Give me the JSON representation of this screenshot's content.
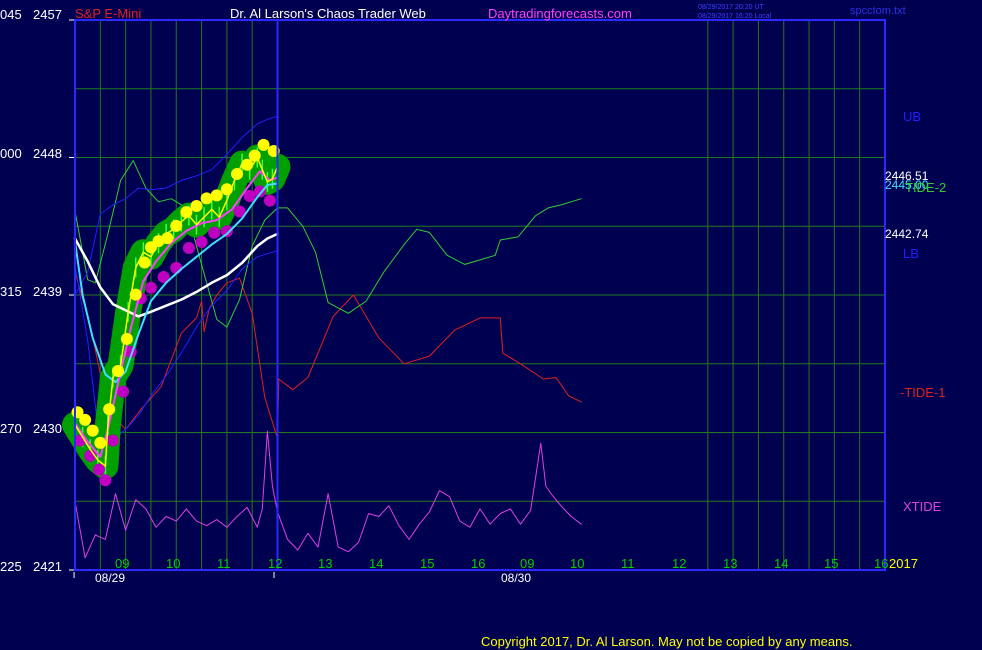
{
  "header": {
    "symbol": "S&P E-Mini",
    "title": "Dr. Al Larson's Chaos Trader Web",
    "site": "Daytradingforecasts.com",
    "timestamp_ut": "08/29/2017 20:20 UT",
    "timestamp_local": "08/29/2017 16:20 Local",
    "filename": "spcctom.txt"
  },
  "footer": {
    "copyright": "Copyright 2017, Dr. Al Larson. May not be copied by any means."
  },
  "colors": {
    "background": "#000050",
    "frame": "#2a2aff",
    "grid": "#1f7a1f",
    "price_band": "#00a000",
    "price_line": "#ffff00",
    "fast_avg": "#ff40ff",
    "slow_avg": "#40e0ff",
    "long_avg": "#ffffff",
    "band": "#2020ff",
    "tide1": "#e02020",
    "tide2": "#30d030",
    "xtide": "#e040e0"
  },
  "chart_data": {
    "type": "line",
    "title": "S&P E-Mini",
    "y_left_ticks": [
      {
        "code": "045",
        "price": "2457",
        "value": 2457
      },
      {
        "code": "000",
        "price": "2448",
        "value": 2448
      },
      {
        "code": "315",
        "price": "2439",
        "value": 2439
      },
      {
        "code": "270",
        "price": "2430",
        "value": 2430
      },
      {
        "code": "225",
        "price": "2421",
        "value": 2421
      }
    ],
    "ylim": [
      2421,
      2457
    ],
    "x_hour_ticks": [
      "09",
      "10",
      "11",
      "12",
      "13",
      "14",
      "15",
      "16",
      "09",
      "10",
      "11",
      "12",
      "13",
      "14",
      "15",
      "16"
    ],
    "x_hour_values": [
      9,
      10,
      11,
      12,
      13,
      14,
      15,
      16,
      33,
      34,
      35,
      36,
      37,
      38,
      39,
      40
    ],
    "xlim": [
      8.0,
      40.0
    ],
    "day_labels": [
      {
        "label": "08/29",
        "x": 8.2
      },
      {
        "label": "08/30",
        "x": 16.1
      }
    ],
    "year_label": "2017",
    "now_x": 16.0,
    "right_labels": {
      "ub": "UB",
      "lb": "LB",
      "tide2": "TIDE-2",
      "tide1": "-TIDE-1",
      "xtide": "XTIDE",
      "ub_value": "2446.51",
      "lb_value": "2442.74",
      "tide2_value": "2445.00"
    },
    "series": [
      {
        "name": "price",
        "x": [
          8.0,
          8.3,
          8.6,
          8.9,
          9.2,
          9.3,
          9.5,
          9.8,
          10.1,
          10.4,
          10.7,
          11.0,
          11.3,
          11.6,
          11.9,
          12.2,
          12.5,
          12.8,
          13.1,
          13.4,
          13.7,
          14.0,
          14.3,
          14.6,
          14.9,
          15.2,
          15.4,
          15.6,
          15.8,
          16.0
        ],
        "values": [
          2430.5,
          2429.7,
          2428.9,
          2428.2,
          2427.8,
          2430.5,
          2433.6,
          2434.4,
          2437.9,
          2440.8,
          2441.8,
          2441.5,
          2442.4,
          2443.0,
          2443.3,
          2443.8,
          2444.2,
          2443.6,
          2444.1,
          2444.6,
          2444.1,
          2445.2,
          2446.5,
          2447.6,
          2447.2,
          2448.0,
          2447.2,
          2446.4,
          2446.6,
          2447.4
        ]
      },
      {
        "name": "fast_avg",
        "x": [
          8.0,
          8.5,
          9.0,
          9.3,
          9.7,
          10.2,
          10.7,
          11.2,
          11.8,
          12.4,
          13.0,
          13.6,
          14.2,
          14.8,
          15.3,
          15.7,
          16.0
        ],
        "values": [
          2430.6,
          2429.4,
          2428.4,
          2430.2,
          2433.2,
          2436.8,
          2439.9,
          2441.2,
          2442.4,
          2443.2,
          2443.7,
          2443.9,
          2444.6,
          2446.0,
          2447.1,
          2446.5,
          2446.7
        ]
      },
      {
        "name": "slow_avg",
        "x": [
          8.0,
          8.3,
          8.7,
          9.2,
          9.6,
          10.0,
          10.5,
          11.0,
          11.6,
          12.2,
          12.8,
          13.4,
          14.0,
          14.6,
          15.2,
          15.6,
          16.0
        ],
        "values": [
          2442.5,
          2439.0,
          2436.2,
          2433.8,
          2433.3,
          2434.0,
          2436.4,
          2438.6,
          2439.8,
          2440.7,
          2441.5,
          2442.3,
          2443.0,
          2444.0,
          2445.4,
          2446.2,
          2446.3
        ]
      },
      {
        "name": "long_avg",
        "x": [
          8.0,
          8.5,
          9.0,
          9.5,
          10.0,
          10.5,
          11.0,
          11.6,
          12.2,
          12.8,
          13.4,
          14.0,
          14.6,
          15.2,
          15.6,
          16.0
        ],
        "values": [
          2442.7,
          2441.2,
          2439.5,
          2438.4,
          2438.0,
          2437.6,
          2437.9,
          2438.3,
          2438.7,
          2439.2,
          2439.8,
          2440.3,
          2441.1,
          2442.2,
          2442.7,
          2443.0
        ]
      },
      {
        "name": "upper_band",
        "x": [
          8.0,
          8.5,
          9.0,
          9.5,
          10.0,
          10.5,
          11.0,
          11.6,
          12.2,
          12.8,
          13.4,
          14.0,
          14.6,
          15.2,
          15.6,
          16.0
        ],
        "values": [
          2439.0,
          2440.5,
          2444.3,
          2444.9,
          2445.3,
          2446.0,
          2445.9,
          2446.0,
          2446.5,
          2446.8,
          2447.2,
          2448.2,
          2449.3,
          2450.2,
          2450.5,
          2450.7
        ]
      },
      {
        "name": "lower_band",
        "x": [
          8.0,
          8.5,
          9.0,
          9.5,
          10.0,
          10.5,
          11.0,
          11.6,
          12.2,
          12.8,
          13.4,
          14.0,
          14.6,
          15.2,
          15.6,
          16.0
        ],
        "values": [
          2441.0,
          2436.0,
          2429.0,
          2429.5,
          2430.2,
          2431.1,
          2432.4,
          2433.7,
          2435.2,
          2436.9,
          2438.3,
          2439.3,
          2440.7,
          2441.5,
          2441.7,
          2441.9
        ]
      },
      {
        "name": "tide1",
        "x": [
          8.0,
          8.6,
          9.3,
          10.0,
          10.6,
          11.4,
          12.2,
          12.8,
          13.0,
          13.1,
          13.3,
          13.6,
          14.0,
          14.5,
          15.0,
          15.5,
          16.0,
          16.05,
          16.6,
          17.2,
          18.2,
          19.0,
          20.0,
          21.0,
          22.0,
          23.0,
          24.0,
          24.8,
          24.9,
          25.6,
          26.5,
          27.0,
          27.3,
          27.5,
          28.0
        ],
        "values": [
          2440.5,
          2437.0,
          2431.5,
          2430.2,
          2431.5,
          2433.0,
          2436.5,
          2437.5,
          2438.6,
          2436.6,
          2438.1,
          2439.0,
          2439.8,
          2440.1,
          2437.8,
          2432.3,
          2429.6,
          2433.5,
          2432.8,
          2433.6,
          2437.6,
          2439.0,
          2436.2,
          2434.5,
          2435.0,
          2436.7,
          2437.5,
          2437.5,
          2435.2,
          2434.5,
          2433.5,
          2433.6,
          2432.9,
          2432.4,
          2432.0
        ]
      },
      {
        "name": "tide2",
        "x": [
          8.0,
          8.5,
          8.8,
          9.3,
          9.8,
          10.3,
          10.8,
          11.3,
          11.8,
          12.4,
          12.8,
          13.2,
          13.6,
          14.0,
          14.5,
          15.0,
          15.5,
          16.0,
          16.4,
          17.0,
          17.5,
          18.0,
          18.8,
          19.5,
          20.2,
          21.0,
          21.5,
          22.0,
          22.7,
          23.4,
          24.0,
          24.6,
          24.8,
          25.5,
          26.2,
          26.7,
          27.2,
          28.0
        ],
        "values": [
          2444.5,
          2440.0,
          2439.8,
          2443.0,
          2446.5,
          2447.8,
          2446.0,
          2445.1,
          2445.3,
          2444.7,
          2442.2,
          2439.8,
          2437.4,
          2436.9,
          2438.7,
          2442.2,
          2443.9,
          2444.7,
          2444.7,
          2443.5,
          2441.8,
          2438.5,
          2437.8,
          2438.6,
          2440.5,
          2442.3,
          2443.3,
          2443.1,
          2441.6,
          2441.0,
          2441.3,
          2441.6,
          2442.6,
          2442.8,
          2444.2,
          2444.7,
          2444.9,
          2445.3
        ]
      },
      {
        "name": "xtide",
        "x": [
          8.0,
          8.4,
          8.8,
          9.2,
          9.6,
          10.0,
          10.4,
          10.8,
          11.2,
          11.6,
          12.0,
          12.4,
          12.8,
          13.2,
          13.6,
          14.0,
          14.4,
          14.8,
          15.2,
          15.4,
          15.6,
          15.8,
          16.0,
          16.4,
          16.8,
          17.2,
          17.6,
          18.0,
          18.4,
          18.8,
          19.2,
          19.6,
          20.0,
          20.4,
          20.8,
          21.2,
          21.6,
          22.0,
          22.4,
          22.8,
          23.2,
          23.6,
          24.0,
          24.4,
          24.8,
          25.2,
          25.6,
          26.0,
          26.4,
          26.6,
          26.8,
          27.2,
          27.6,
          28.0
        ],
        "values": [
          2425.5,
          2421.8,
          2423.3,
          2423.0,
          2426.0,
          2423.6,
          2425.6,
          2425.0,
          2423.8,
          2424.5,
          2424.2,
          2425.0,
          2424.2,
          2423.9,
          2424.3,
          2423.8,
          2424.5,
          2425.1,
          2423.8,
          2425.0,
          2430.1,
          2426.5,
          2424.8,
          2423.0,
          2422.3,
          2423.4,
          2422.5,
          2426.0,
          2422.5,
          2422.2,
          2422.8,
          2424.7,
          2424.5,
          2425.2,
          2423.9,
          2423.0,
          2424.0,
          2424.8,
          2426.2,
          2425.8,
          2424.2,
          2423.8,
          2425.0,
          2424.0,
          2424.7,
          2425.0,
          2424.0,
          2424.9,
          2429.3,
          2426.5,
          2426.0,
          2425.2,
          2424.5,
          2424.0
        ]
      }
    ],
    "bullish_points": {
      "x": [
        8.1,
        8.4,
        8.7,
        9.0,
        9.35,
        9.7,
        10.05,
        10.4,
        10.75,
        11.0,
        11.3,
        11.65,
        12.0,
        12.4,
        12.8,
        13.2,
        13.6,
        14.0,
        14.4,
        14.8,
        15.1,
        15.45,
        15.85
      ],
      "values": [
        2430.8,
        2430.3,
        2429.6,
        2428.8,
        2431.0,
        2433.5,
        2435.6,
        2438.5,
        2440.6,
        2441.6,
        2442.0,
        2442.2,
        2443.0,
        2443.9,
        2444.3,
        2444.8,
        2445.0,
        2445.4,
        2446.4,
        2447.0,
        2447.6,
        2448.3,
        2447.9
      ]
    },
    "bearish_points": {
      "x": [
        8.2,
        8.6,
        8.95,
        9.2,
        9.5,
        9.9,
        10.2,
        10.6,
        11.0,
        11.5,
        12.0,
        12.5,
        13.0,
        13.5,
        14.0,
        14.5,
        14.9,
        15.3,
        15.7
      ],
      "values": [
        2430.0,
        2429.0,
        2428.1,
        2427.4,
        2430.0,
        2433.2,
        2435.8,
        2439.3,
        2440.0,
        2440.7,
        2441.3,
        2442.6,
        2443.0,
        2443.6,
        2443.7,
        2445.0,
        2446.0,
        2446.3,
        2445.7
      ]
    }
  }
}
